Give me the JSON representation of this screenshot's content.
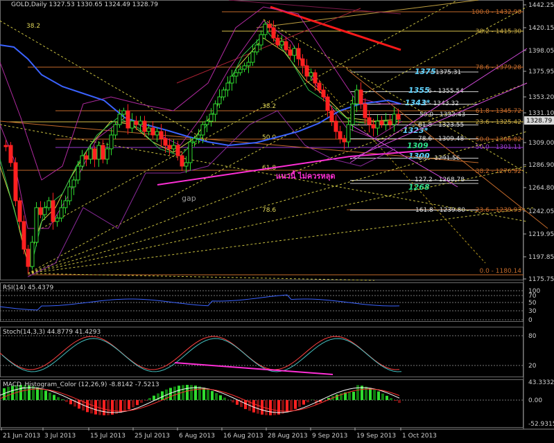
{
  "main_header": {
    "symbol": "GOLD,Daily",
    "ohlc": "1327.53 1330.65 1324.49 1328.79"
  },
  "rsi_header": {
    "label": "RSI(14) 45.4379"
  },
  "stoch_header": {
    "label": "Stoch(14,3,3) 44.8779 41.4293"
  },
  "macd_header": {
    "label": "MACD_Histogram_Color (12,26,9) -8.8142 -7.5213"
  },
  "current_price": "1328.79",
  "price_axis": [
    "1442.25",
    "1420.15",
    "1398.05",
    "1375.95",
    "1353.20",
    "1331.10",
    "1309.00",
    "1286.90",
    "1264.80",
    "1242.05",
    "1219.95",
    "1197.85",
    "1175.75"
  ],
  "rsi_axis": [
    "100",
    "70",
    "50",
    "30",
    "0"
  ],
  "stoch_axis": [
    "80",
    "20"
  ],
  "macd_axis": [
    "43.3332",
    "0.00",
    "-52.9315"
  ],
  "date_axis": [
    "21 Jun 2013",
    "3 Jul 2013",
    "15 Jul 2013",
    "25 Jul 2013",
    "6 Aug 2013",
    "16 Aug 2013",
    "28 Aug 2013",
    "9 Sep 2013",
    "19 Sep 2013",
    "1 Oct 2013"
  ],
  "fib_right": [
    {
      "text": "100.0 - 1432.90",
      "color": "#c46a2a"
    },
    {
      "text": "38.2 - 1415.30",
      "color": "#c2a240"
    },
    {
      "text": "78.6 - 1379.28",
      "color": "#c46a2a"
    },
    {
      "text": "61.8 - 1345.72",
      "color": "#c46a2a"
    },
    {
      "text": "23.6 - 1325.42",
      "color": "#c2a240"
    },
    {
      "text": "50.0 - 1306.82",
      "color": "#c46a2a"
    },
    {
      "text": "50.0 - 1301.11",
      "color": "#9a3ad0"
    },
    {
      "text": "38.2 - 1276.92",
      "color": "#c46a2a"
    },
    {
      "text": "23.6 - 1239.93",
      "color": "#c46a2a"
    },
    {
      "text": "0.0 - 1180.14",
      "color": "#c46a2a"
    }
  ],
  "fib_mid": [
    {
      "text": "1375.31",
      "color": "#e0e0e0"
    },
    {
      "text": "6 - 1355.54",
      "color": "#e0e0e0"
    },
    {
      "text": "2 - 1343.32",
      "color": "#e0e0e0"
    },
    {
      "text": "50.0 - 1333.43",
      "color": "#e0e0e0"
    },
    {
      "text": "61.8 - 1323.55",
      "color": "#e0e0e0"
    },
    {
      "text": "78.6 - 1309.48",
      "color": "#e0e0e0"
    },
    {
      "text": "0.0 - 1291.56",
      "color": "#e0e0e0"
    },
    {
      "text": "127.2 - 1268.78",
      "color": "#e0e0e0"
    },
    {
      "text": "161.8 - 1239.80",
      "color": "#e0e0e0"
    }
  ],
  "fib_yellow": [
    "38.2",
    "38.2",
    "50.0",
    "61.8",
    "78.6"
  ],
  "levels": [
    {
      "text": "1375",
      "color": "#5fd3ff"
    },
    {
      "text": "1355",
      "color": "#5fd3ff"
    },
    {
      "text": "1343*",
      "color": "#5fd3ff"
    },
    {
      "text": "1323*",
      "color": "#5fd3ff"
    },
    {
      "text": "1309",
      "color": "#2ee08a"
    },
    {
      "text": "1300",
      "color": "#5fd3ff"
    },
    {
      "text": "1268",
      "color": "#2ee08a"
    }
  ],
  "annotations": {
    "thai": "แนวนี้ ไม่ควรหลุด",
    "gap": "gap"
  },
  "colors": {
    "bull": "#2fdc2f",
    "bear": "#ff2020",
    "ma_blue": "#3b63ff",
    "trend_red": "#ff1a1a",
    "magenta": "#ff2fd6",
    "fib_orange": "#c46a2a",
    "fib_yellow": "#d8c04a"
  }
}
